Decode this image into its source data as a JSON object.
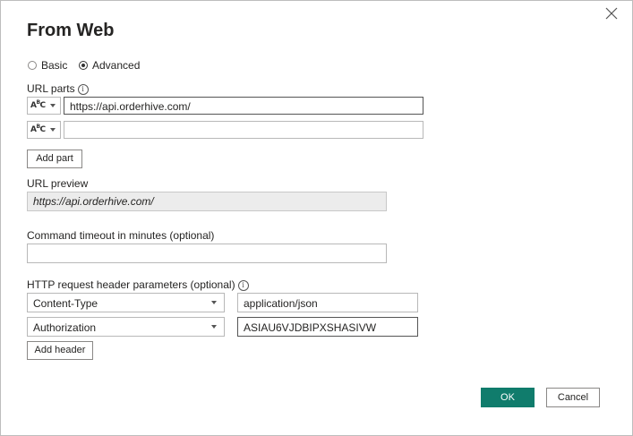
{
  "dialog": {
    "title": "From Web",
    "close_icon": "close-icon"
  },
  "mode": {
    "basic_label": "Basic",
    "advanced_label": "Advanced",
    "selected": "Advanced"
  },
  "url_parts": {
    "label": "URL parts",
    "info_icon": "info-icon",
    "type_icon": "text-type-icon",
    "parts": [
      {
        "value": "https://api.orderhive.com/"
      },
      {
        "value": ""
      }
    ],
    "add_part_label": "Add part"
  },
  "url_preview": {
    "label": "URL preview",
    "value": "https://api.orderhive.com/"
  },
  "timeout": {
    "label": "Command timeout in minutes (optional)",
    "value": ""
  },
  "headers": {
    "label": "HTTP request header parameters (optional)",
    "info_icon": "info-icon",
    "rows": [
      {
        "name": "Content-Type",
        "value": "application/json"
      },
      {
        "name": "Authorization",
        "value": "ASIAU6VJDBIPXSHASIVW"
      }
    ],
    "add_header_label": "Add header"
  },
  "footer": {
    "ok_label": "OK",
    "cancel_label": "Cancel",
    "ok_color": "#107c6c"
  }
}
